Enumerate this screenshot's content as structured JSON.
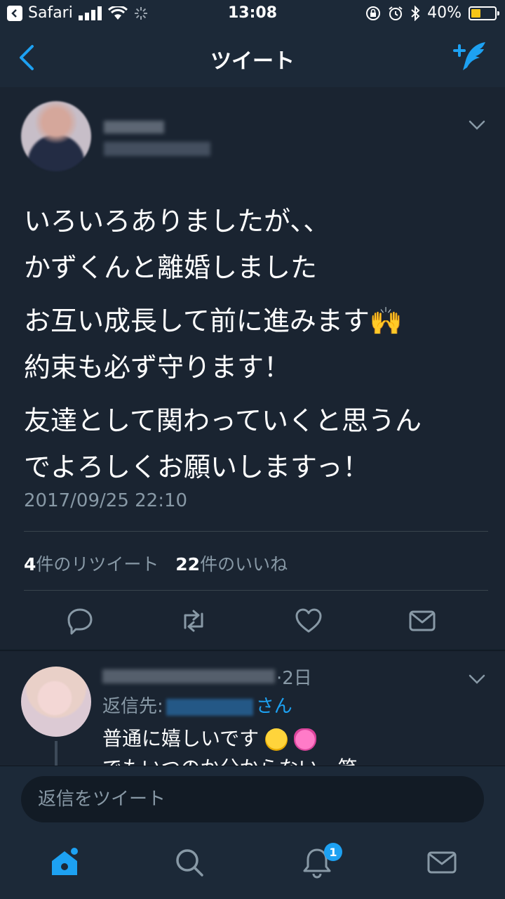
{
  "status_bar": {
    "back_app": "Safari",
    "time": "13:08",
    "battery_percent": "40%",
    "battery_level": 0.4
  },
  "nav": {
    "title": "ツイート"
  },
  "tweet": {
    "paragraphs": [
      [
        "いろいろありましたが、、",
        "かずくんと離婚しました"
      ],
      [
        "お互い成長して前に進みます🙌",
        "約束も必ず守ります！"
      ],
      [
        "友達として関わっていくと思うん",
        "でよろしくお願いしますっ！"
      ]
    ],
    "timestamp": "2017/09/25 22:10",
    "retweet_count": "4",
    "retweet_label": "件のリツイート",
    "like_count": "22",
    "like_label": "件のいいね"
  },
  "reply": {
    "time": "·2日",
    "reply_to_prefix": "返信先:",
    "reply_to_suffix": "さん",
    "text_line1": "普通に嬉しいです",
    "text_line2": "でもいつのか分からない　笑"
  },
  "composer": {
    "placeholder": "返信をツイート"
  },
  "tab_bar": {
    "notification_badge": "1"
  },
  "colors": {
    "background": "#15202b",
    "accent": "#1da1f2",
    "secondary_text": "#8899a6"
  }
}
